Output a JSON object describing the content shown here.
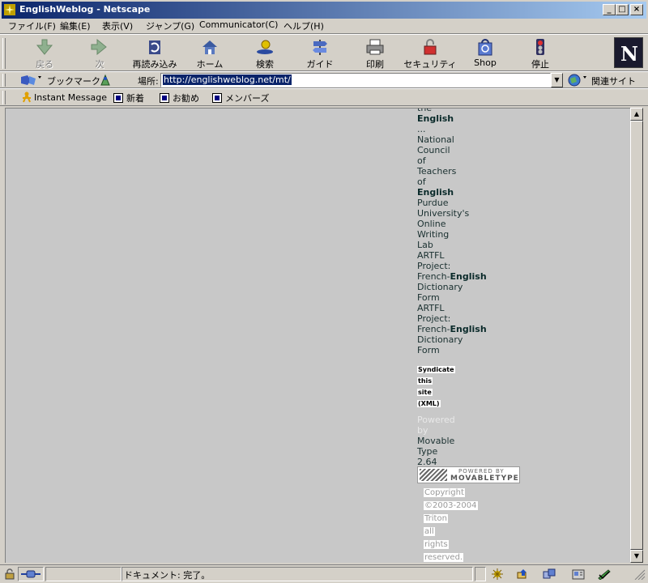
{
  "window": {
    "title": "EnglishWeblog - Netscape",
    "controls": [
      "_",
      "□",
      "×"
    ]
  },
  "menu": [
    "ファイル(F)",
    "編集(E)",
    "表示(V)",
    "ジャンプ(G)",
    "Communicator(C)",
    "ヘルプ(H)"
  ],
  "nav": {
    "back": "戻る",
    "forward": "次",
    "reload": "再読み込み",
    "home": "ホーム",
    "search": "検索",
    "guide": "ガイド",
    "print": "印刷",
    "security": "セキュリティ",
    "shop": "Shop",
    "stop": "停止",
    "logo": "N"
  },
  "location": {
    "bookmarks": "ブックマーク",
    "label": "場所:",
    "url": "http://englishweblog.net/mt/",
    "related": "関連サイト"
  },
  "personal": {
    "instant_message": "Instant Message",
    "items": [
      "新着",
      "お勧め",
      "メンバーズ"
    ]
  },
  "content": {
    "words": [
      {
        "t": "the",
        "bold": false
      },
      {
        "t": "English",
        "bold": true
      },
      {
        "t": "...",
        "bold": false
      },
      {
        "t": "National",
        "bold": false
      },
      {
        "t": "Council",
        "bold": false
      },
      {
        "t": "of",
        "bold": false
      },
      {
        "t": "Teachers",
        "bold": false
      },
      {
        "t": "of",
        "bold": false
      },
      {
        "t": "English",
        "bold": true
      },
      {
        "t": "Purdue",
        "bold": false
      },
      {
        "t": "University's",
        "bold": false
      },
      {
        "t": "Online",
        "bold": false
      },
      {
        "t": "Writing",
        "bold": false
      },
      {
        "t": "Lab",
        "bold": false
      },
      {
        "t": "ARTFL",
        "bold": false
      },
      {
        "t": "Project:",
        "bold": false
      },
      {
        "t": "French-",
        "bold": false,
        "suffix": "English"
      },
      {
        "t": "Dictionary",
        "bold": false
      },
      {
        "t": "Form",
        "bold": false
      },
      {
        "t": "ARTFL",
        "bold": false
      },
      {
        "t": "Project:",
        "bold": false
      },
      {
        "t": "French-",
        "bold": false,
        "suffix": "English"
      },
      {
        "t": "Dictionary",
        "bold": false
      },
      {
        "t": "Form",
        "bold": false
      }
    ],
    "syndicate": [
      "Syndicate",
      "this",
      "site",
      "(XML)"
    ],
    "powered_faded": [
      "Powered",
      "by"
    ],
    "powered_dark": [
      "Movable",
      "Type",
      "2.64"
    ],
    "badge": {
      "line1": "POWERED BY",
      "line2": "MOVABLETYPE"
    },
    "copyright": [
      "Copyright",
      "©2003-2004",
      "Triton",
      "all",
      "rights",
      "reserved."
    ]
  },
  "status": {
    "text": "ドキュメント: 完了。"
  }
}
